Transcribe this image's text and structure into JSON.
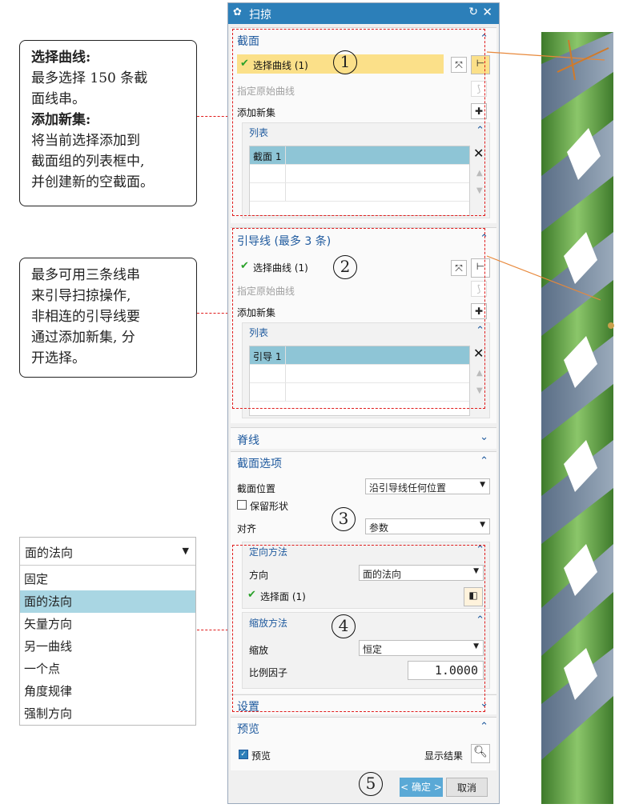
{
  "callouts": {
    "c1": {
      "head1": "选择曲线:",
      "l1": "最多选择 150 条截",
      "l2": "面线串。",
      "head2": "添加新集:",
      "l3": "将当前选择添加到",
      "l4": "截面组的列表框中,",
      "l5": "并创建新的空截面。"
    },
    "c2": {
      "l1": "最多可用三条线串",
      "l2": "来引导扫掠操作,",
      "l3": "非相连的引导线要",
      "l4": "通过添加新集, 分",
      "l5": "开选择。"
    }
  },
  "dialog": {
    "title": "扫掠",
    "section": {
      "title": "截面",
      "select_curve": "选择曲线 (1)",
      "specify_origin": "指定原始曲线",
      "add_new_set": "添加新集",
      "list_title": "列表",
      "list_item": "截面 1"
    },
    "guide": {
      "title": "引导线 (最多 3 条)",
      "select_curve": "选择曲线 (1)",
      "specify_origin": "指定原始曲线",
      "add_new_set": "添加新集",
      "list_title": "列表",
      "list_item": "引导 1"
    },
    "spine": {
      "title": "脊线"
    },
    "section_options": {
      "title": "截面选项",
      "position_label": "截面位置",
      "position_value": "沿引导线任何位置",
      "preserve_shape": "保留形状",
      "align_label": "对齐",
      "align_value": "参数",
      "orient": {
        "title": "定向方法",
        "direction_label": "方向",
        "direction_value": "面的法向",
        "select_face": "选择面 (1)"
      },
      "scale": {
        "title": "缩放方法",
        "scale_label": "缩放",
        "scale_value": "恒定",
        "factor_label": "比例因子",
        "factor_value": "1.0000"
      }
    },
    "settings": {
      "title": "设置"
    },
    "preview": {
      "title": "预览",
      "checkbox_label": "预览",
      "show_result": "显示结果"
    },
    "buttons": {
      "ok": "< 确定 >",
      "cancel": "取消"
    }
  },
  "markers": {
    "m1": "1",
    "m2": "2",
    "m3": "3",
    "m4": "4",
    "m5": "5"
  },
  "dropdown_list": {
    "selected": "面的法向",
    "options": [
      "固定",
      "面的法向",
      "矢量方向",
      "另一曲线",
      "一个点",
      "角度规律",
      "强制方向"
    ]
  },
  "colors": {
    "title_bar": "#2c7fb9",
    "highlight": "#fbe089",
    "list_selected": "#8ec5d6",
    "annotation": "#e01c1c",
    "model_green": "#5c9c3e"
  }
}
